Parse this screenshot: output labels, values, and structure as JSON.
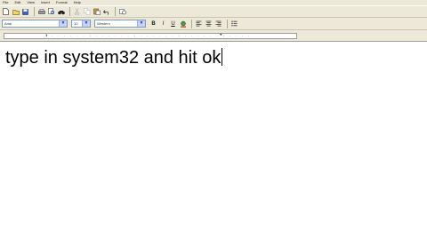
{
  "menu": {
    "items": [
      "File",
      "Edit",
      "View",
      "Insert",
      "Format",
      "Help"
    ]
  },
  "toolbar": {
    "buttons": [
      "new-icon",
      "open-icon",
      "save-icon",
      "print-icon",
      "print-preview-icon",
      "find-icon",
      "cut-icon",
      "copy-icon",
      "paste-icon",
      "undo-icon",
      "date-time-icon"
    ]
  },
  "format": {
    "font_name": "Arial",
    "font_size": "10",
    "script": "Western",
    "bold": "B",
    "italic": "I",
    "underline": "U"
  },
  "document": {
    "text": "type in system32 and hit ok"
  }
}
